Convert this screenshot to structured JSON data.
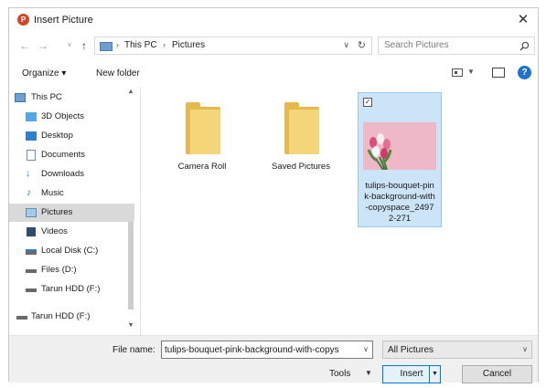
{
  "window": {
    "title": "Insert Picture",
    "app_icon_letter": "P",
    "close_glyph": "✕"
  },
  "nav": {
    "back": "←",
    "forward": "→",
    "up": "↑",
    "address": [
      "This PC",
      "Pictures"
    ],
    "address_separator": "›",
    "address_dropdown": "∨",
    "refresh": "↻",
    "search_placeholder": "Search Pictures"
  },
  "toolbar": {
    "organize_label": "Organize ▾",
    "new_folder_label": "New folder",
    "help_glyph": "?"
  },
  "sidebar": {
    "items": [
      {
        "label": "This PC"
      },
      {
        "label": "3D Objects"
      },
      {
        "label": "Desktop"
      },
      {
        "label": "Documents"
      },
      {
        "label": "Downloads"
      },
      {
        "label": "Music"
      },
      {
        "label": "Pictures"
      },
      {
        "label": "Videos"
      },
      {
        "label": "Local Disk (C:)"
      },
      {
        "label": "Files (D:)"
      },
      {
        "label": "Tarun HDD (F:)"
      },
      {
        "label": "Tarun HDD (F:)"
      }
    ],
    "selected_index": 6,
    "scroll_up": "▲",
    "scroll_down": "▼"
  },
  "files": [
    {
      "name": "Camera Roll",
      "type": "folder"
    },
    {
      "name": "Saved Pictures",
      "type": "folder"
    },
    {
      "name": "tulips-bouquet-pink-background-with-copyspace_24972-271",
      "type": "image",
      "selected": true,
      "checkbox": "✓"
    }
  ],
  "bottom": {
    "file_name_label": "File name:",
    "file_name_value": "tulips-bouquet-pink-background-with-copys",
    "file_name_dropdown": "∨",
    "filter_value": "All Pictures",
    "filter_dropdown": "∨",
    "tools_label": "Tools",
    "tools_dropdown": "▼",
    "insert_label": "Insert",
    "insert_split": "▼",
    "cancel_label": "Cancel"
  },
  "colors": {
    "accent": "#0078d7",
    "selection": "#cce4f7",
    "folder": "#e6b94c",
    "thumbnail": "#eeb8c6"
  }
}
